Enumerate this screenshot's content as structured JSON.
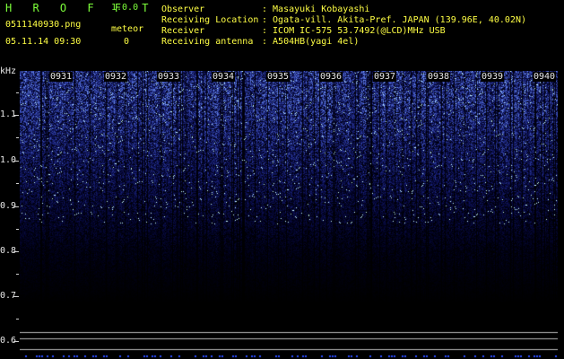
{
  "app": {
    "name": "H R O F F T",
    "version": "1.0.0"
  },
  "file": {
    "name": "0511140930.png",
    "timestamp": "05.11.14 09:30"
  },
  "meteor": {
    "label": "meteor",
    "count": "0"
  },
  "info": [
    {
      "label": "Observer",
      "value": ": Masayuki Kobayashi"
    },
    {
      "label": "Receiving Location",
      "value": ": Ogata-vill. Akita-Pref. JAPAN (139.96E, 40.02N)"
    },
    {
      "label": "Receiver",
      "value": ": ICOM IC-575 53.7492(@LCD)MHz USB"
    },
    {
      "label": "Receiving antenna",
      "value": ": A504HB(yagi 4el)"
    }
  ],
  "axis": {
    "unit": "kHz",
    "labels": [
      "1.1",
      "1.0",
      "0.9",
      "0.8",
      "0.7",
      "0.6"
    ]
  },
  "time_labels": [
    "0931",
    "0932",
    "0933",
    "0934",
    "0935",
    "0936",
    "0937",
    "0938",
    "0939",
    "0940"
  ],
  "colors": {
    "text_yellow": "#ffff44",
    "text_green": "#7dff3a",
    "text_white": "#e8e8e8",
    "signal_blue": "#3a5cff",
    "background": "#000000"
  }
}
